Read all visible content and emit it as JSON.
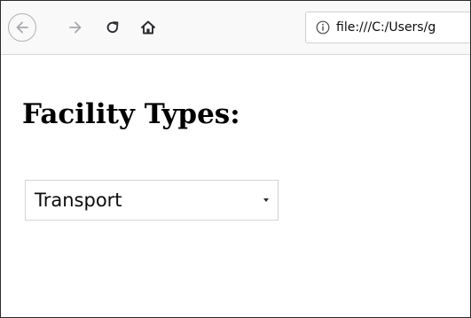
{
  "browser": {
    "url": "file:///C:/Users/g"
  },
  "page": {
    "heading": "Facility Types:",
    "facility_select": {
      "selected": "Transport"
    }
  },
  "icons": {
    "back": "back-arrow-icon",
    "forward": "forward-arrow-icon",
    "reload": "reload-icon",
    "home": "home-icon",
    "info": "info-icon",
    "dropdown": "dropdown-arrow-icon"
  }
}
